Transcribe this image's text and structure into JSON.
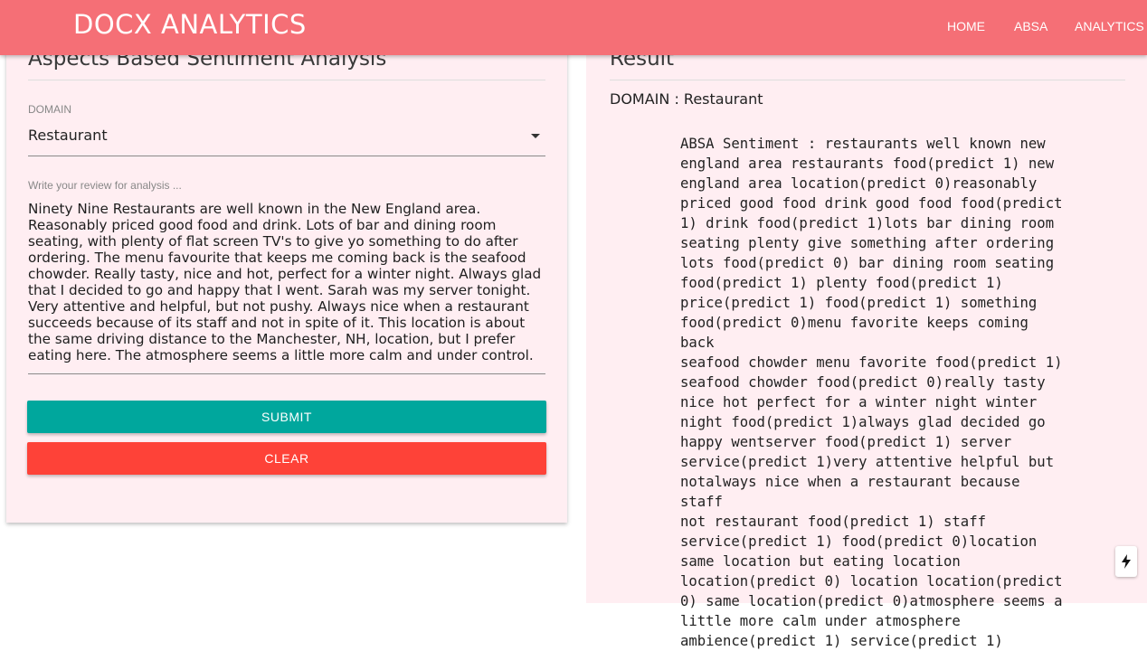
{
  "navbar": {
    "brand": "DOCX ANALYTICS",
    "links": [
      "HOME",
      "ABSA",
      "ANALYTICS"
    ],
    "color": "#f56f76"
  },
  "left_panel": {
    "title": "Aspects Based Sentiment Analysis",
    "domain_label": "DOMAIN",
    "domain_value": "Restaurant",
    "review_label": "Write your review for analysis ...",
    "review_text": "Ninety Nine Restaurants are well known in the New England area. Reasonably priced good food and drink. Lots of bar and dining room seating, with plenty of flat screen TV's to give yo something to do after ordering. The menu favourite that keeps me coming back is the seafood chowder. Really tasty, nice and hot, perfect for a winter night. Always glad that I decided to go and happy that I went. Sarah was my server tonight. Very attentive and helpful, but not pushy. Always nice when a restaurant succeeds because of its staff and not in spite of it. This location is about the same driving distance to the Manchester, NH, location, but I prefer eating here. The atmosphere seems a little more calm and under control.",
    "submit_label": "SUBMIT",
    "clear_label": "CLEAR",
    "submit_color": "#00a79d",
    "clear_color": "#fe4238"
  },
  "right_panel": {
    "title": "Result",
    "domain_line": "DOMAIN : Restaurant",
    "result_lines": [
      "ABSA Sentiment : restaurants well known new",
      "england area restaurants food(predict 1) new",
      "england area location(predict 0)reasonably",
      "priced good food drink good food food(predict",
      "1) drink food(predict 1)lots bar dining room",
      "seating plenty give something after ordering",
      "lots food(predict 0) bar dining room seating",
      "food(predict 1) plenty food(predict 1)",
      "price(predict 1) food(predict 1) something",
      "food(predict 0)menu favorite keeps coming back",
      "seafood chowder menu favorite food(predict 1)",
      "seafood chowder food(predict 0)really tasty",
      "nice hot perfect for a winter night winter",
      "night food(predict 1)always glad decided go",
      "happy wentserver food(predict 1) server",
      "service(predict 1)very attentive helpful but",
      "notalways nice when a restaurant because staff",
      "not restaurant food(predict 1) staff",
      "service(predict 1) food(predict 0)location",
      "same location but eating location",
      "location(predict 0) location location(predict",
      "0) same location(predict 0)atmosphere seems a",
      "little more calm under atmosphere",
      "ambience(predict 1) service(predict 1)"
    ]
  },
  "panel_background": "#ffeef2"
}
